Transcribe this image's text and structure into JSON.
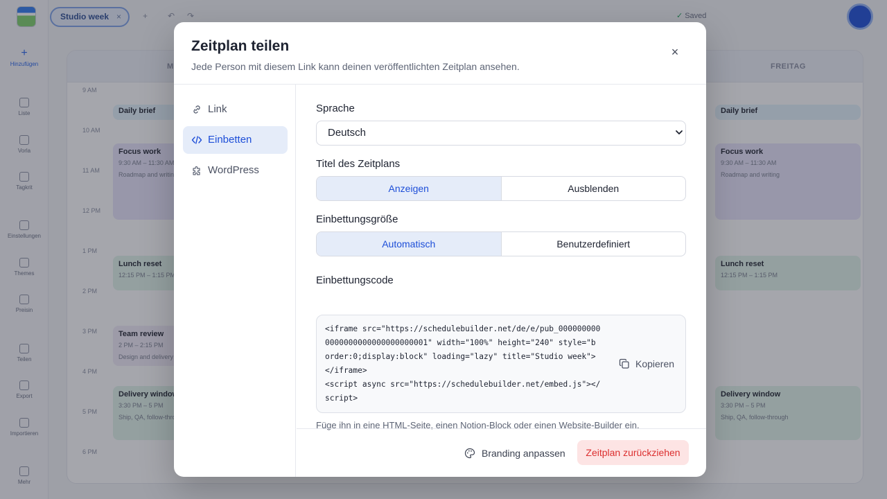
{
  "background": {
    "doc_tab": "Studio week",
    "saved": "Saved",
    "days": [
      "MONTAG",
      "FREITAG"
    ],
    "times": [
      "9 AM",
      "10 AM",
      "11 AM",
      "12 PM",
      "1 PM",
      "2 PM",
      "3 PM",
      "4 PM",
      "5 PM",
      "6 PM"
    ],
    "sidebar": [
      "Hinzufügen",
      "Liste",
      "Vorla",
      "Tagkrit",
      "Einstellungen",
      "Themes",
      "Preisin",
      "Teilen",
      "Export",
      "Importieren",
      "Mehr"
    ],
    "events_left": [
      {
        "title": "Daily brief",
        "time": "",
        "note": ""
      },
      {
        "title": "Focus work",
        "time": "9:30 AM – 11:30 AM",
        "note": "Roadmap and writing"
      },
      {
        "title": "Lunch reset",
        "time": "12:15 PM – 1:15 PM",
        "note": ""
      },
      {
        "title": "Team review",
        "time": "2 PM – 2:15 PM",
        "note": "Design and delivery"
      },
      {
        "title": "Delivery window",
        "time": "3:30 PM – 5 PM",
        "note": "Ship, QA, follow-through"
      }
    ],
    "events_right": [
      {
        "title": "Daily brief",
        "time": "",
        "note": ""
      },
      {
        "title": "Focus work",
        "time": "9:30 AM – 11:30 AM",
        "note": "Roadmap and writing"
      },
      {
        "title": "Lunch reset",
        "time": "12:15 PM – 1:15 PM",
        "note": ""
      },
      {
        "title": "Delivery window",
        "time": "3:30 PM – 5 PM",
        "note": "Ship, QA, follow-through"
      }
    ]
  },
  "modal": {
    "title": "Zeitplan teilen",
    "subtitle": "Jede Person mit diesem Link kann deinen veröffentlichten Zeitplan ansehen.",
    "close": "×",
    "nav": [
      {
        "label": "Link",
        "icon": "link-icon"
      },
      {
        "label": "Einbetten",
        "icon": "code-icon"
      },
      {
        "label": "WordPress",
        "icon": "puzzle-icon"
      }
    ],
    "language_label": "Sprache",
    "language_value": "Deutsch",
    "title_label": "Titel des Zeitplans",
    "title_options": [
      "Anzeigen",
      "Ausblenden"
    ],
    "size_label": "Einbettungsgröße",
    "size_options": [
      "Automatisch",
      "Benutzerdefiniert"
    ],
    "code_label": "Einbettungscode",
    "code_text": "<iframe src=\"https://schedulebuilder.net/de/e/pub_000000000\n0000000000000000000001\" width=\"100%\" height=\"240\" style=\"b\norder:0;display:block\" loading=\"lazy\" title=\"Studio week\">\n</iframe>\n<script async src=\"https://schedulebuilder.net/embed.js\"></\nscript>",
    "copy": "Kopieren",
    "hint": "Füge ihn in eine HTML-Seite, einen Notion-Block oder einen Website-Builder ein.",
    "branding": "Branding anpassen",
    "retract": "Zeitplan zurückziehen",
    "accent_color": "#1d4ed8",
    "danger_color": "#dc2f2f"
  }
}
